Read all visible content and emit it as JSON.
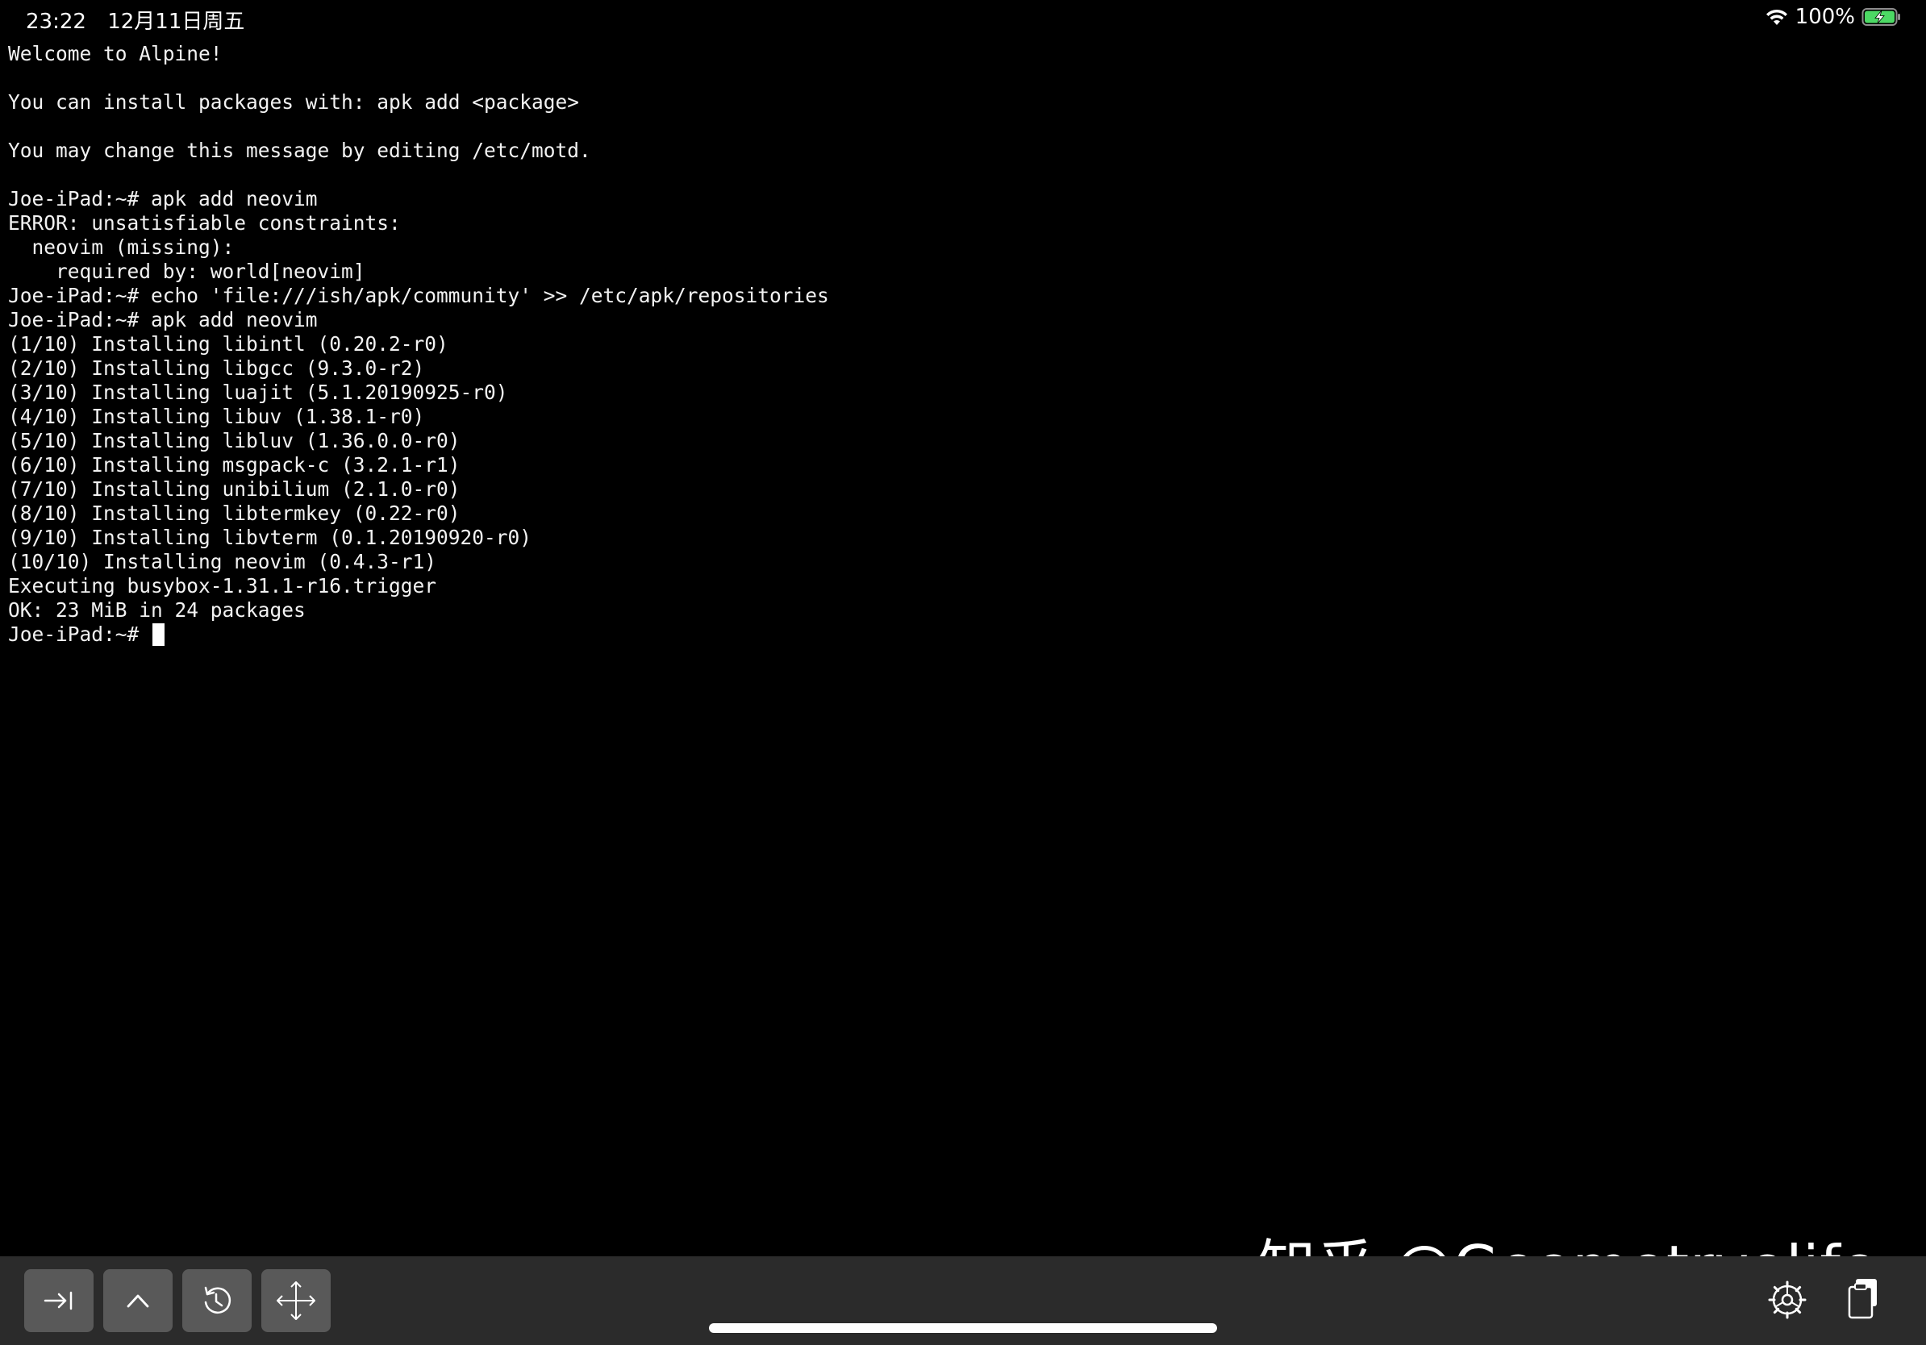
{
  "status_bar": {
    "time": "23:22",
    "date": "12月11日周五",
    "battery_percent": "100%",
    "battery_level": 1.0,
    "battery_color": "#4cd964"
  },
  "terminal": {
    "lines": [
      "Welcome to Alpine!",
      "",
      "You can install packages with: apk add <package>",
      "",
      "You may change this message by editing /etc/motd.",
      "",
      "Joe-iPad:~# apk add neovim",
      "ERROR: unsatisfiable constraints:",
      "  neovim (missing):",
      "    required by: world[neovim]",
      "Joe-iPad:~# echo 'file:///ish/apk/community' >> /etc/apk/repositories",
      "Joe-iPad:~# apk add neovim",
      "(1/10) Installing libintl (0.20.2-r0)",
      "(2/10) Installing libgcc (9.3.0-r2)",
      "(3/10) Installing luajit (5.1.20190925-r0)",
      "(4/10) Installing libuv (1.38.1-r0)",
      "(5/10) Installing libluv (1.36.0.0-r0)",
      "(6/10) Installing msgpack-c (3.2.1-r1)",
      "(7/10) Installing unibilium (2.1.0-r0)",
      "(8/10) Installing libtermkey (0.22-r0)",
      "(9/10) Installing libvterm (0.1.20190920-r0)",
      "(10/10) Installing neovim (0.4.3-r1)",
      "Executing busybox-1.31.1-r16.trigger",
      "OK: 23 MiB in 24 packages"
    ],
    "prompt": "Joe-iPad:~# "
  },
  "toolbar": {
    "buttons": [
      {
        "icon": "tab-key-icon"
      },
      {
        "icon": "control-key-icon"
      },
      {
        "icon": "history-icon"
      },
      {
        "icon": "arrow-keys-icon"
      }
    ],
    "right_icons": [
      "settings-icon",
      "paste-icon"
    ]
  },
  "watermark": "知乎 @Geometryolife"
}
